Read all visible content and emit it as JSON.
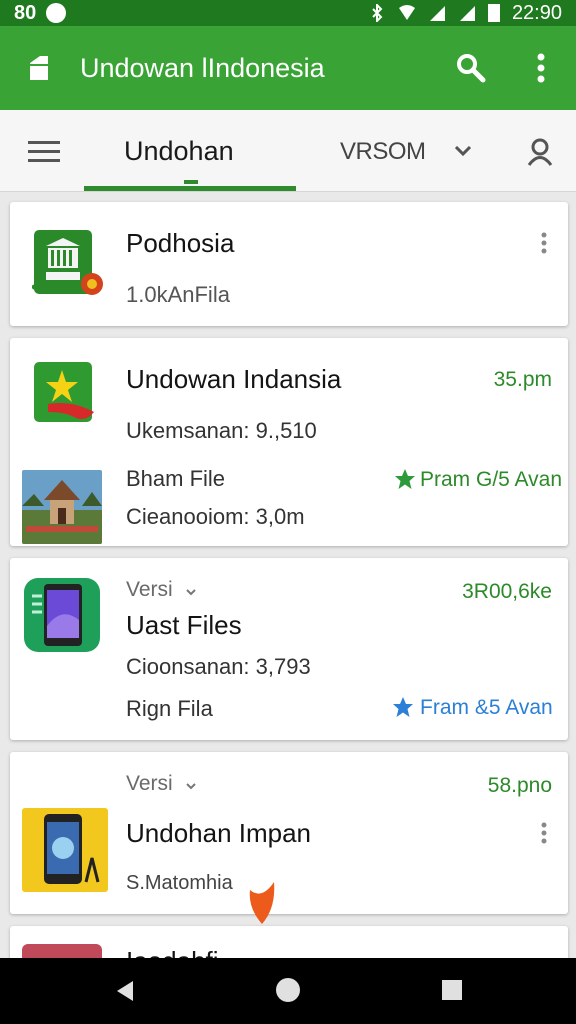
{
  "status_bar": {
    "left_text": "80",
    "time": "22:90"
  },
  "app_bar": {
    "title": "Undowan lIndonesia"
  },
  "tab_bar": {
    "active_tab": "Undohan",
    "version_select": "VRSOM"
  },
  "cards": [
    {
      "title": "Podhosia",
      "subtitle": "1.0kAnFila"
    },
    {
      "title": "Undowan Indansia",
      "time": "35.pm",
      "detail": "Ukemsanan: 9.,510",
      "file_name": "Bham File",
      "file_detail": "Cieanooiom: 3,0m",
      "rating": "Pram G/5 Avan"
    },
    {
      "label": "Versi",
      "size": "3R00,6ke",
      "title": "Uast Files",
      "detail": "Cioonsanan: 3,793",
      "file_name": "Rign Fila",
      "rating": "Fram &5 Avan"
    },
    {
      "label": "Versi",
      "time": "58.pno",
      "title": "Undohan Impan",
      "subtitle": "S.Matomhia"
    },
    {
      "title": "Iaodahfi"
    }
  ],
  "colors": {
    "status_bar": "#1f7a1f",
    "app_bar": "#3aa335",
    "accent_green": "#2d8a2a",
    "star": "#2e9b3a",
    "star_blue": "#2b7fd6"
  },
  "icons": [
    "app-icon",
    "search-icon",
    "more-vert-icon",
    "menu-icon",
    "chevron-down-icon",
    "account-icon",
    "star-icon",
    "back-icon",
    "home-icon",
    "recent-icon"
  ]
}
